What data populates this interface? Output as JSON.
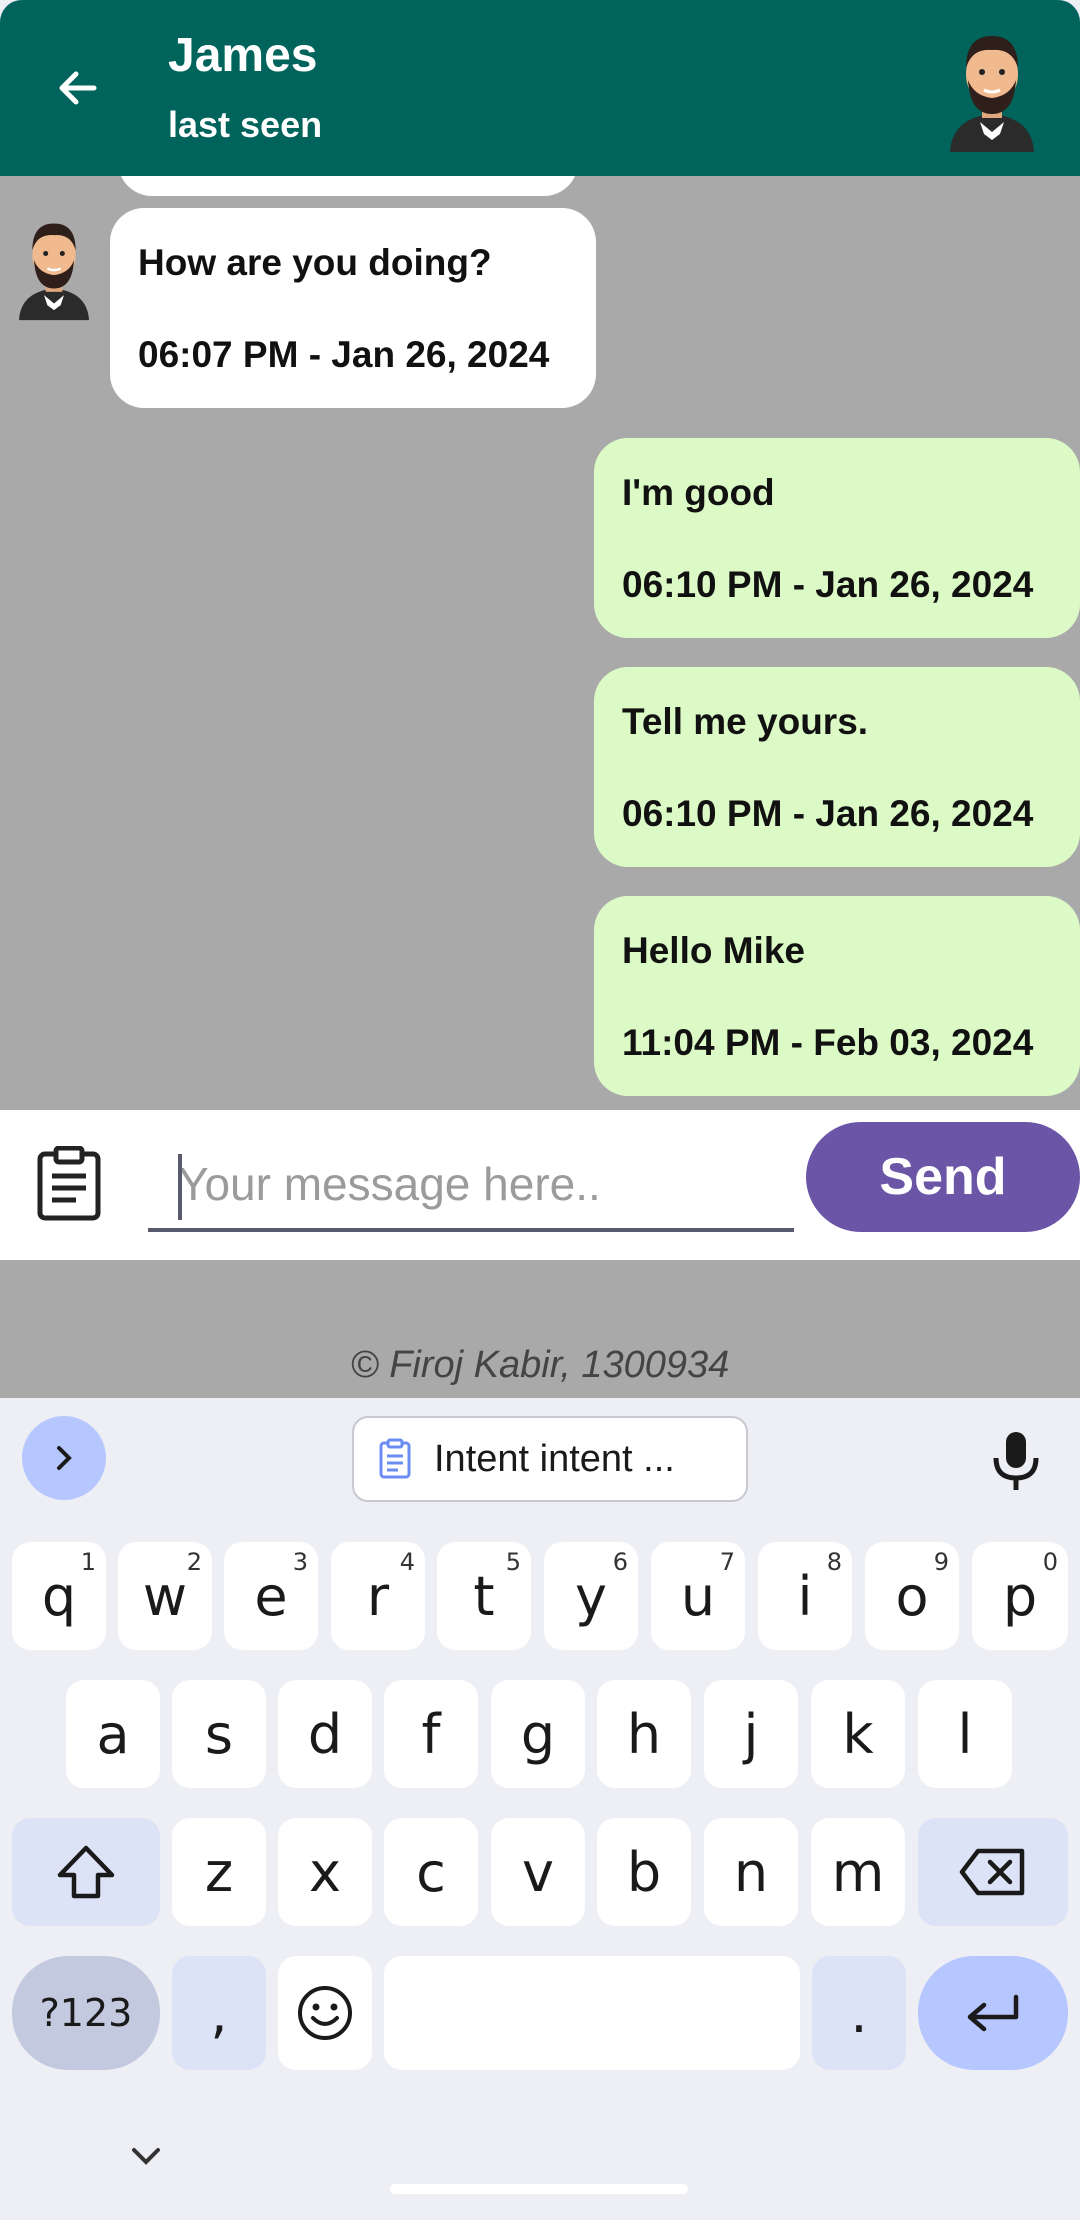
{
  "header": {
    "title": "James",
    "subtitle": "last seen",
    "back_icon": "arrow-left-icon",
    "avatar_icon": "bearded-man-avatar-icon",
    "color": "#00645c"
  },
  "messages": [
    {
      "direction": "incoming",
      "text": "How are you doing?",
      "time": "06:07 PM - Jan 26, 2024"
    },
    {
      "direction": "outgoing",
      "text": "I'm good",
      "time": "06:10 PM - Jan 26, 2024"
    },
    {
      "direction": "outgoing",
      "text": "Tell me yours.",
      "time": "06:10 PM - Jan 26, 2024"
    },
    {
      "direction": "outgoing",
      "text": "Hello Mike",
      "time": "11:04 PM - Feb 03, 2024"
    }
  ],
  "input": {
    "placeholder": "Your message here..",
    "attach_icon": "clipboard-icon",
    "send_label": "Send",
    "send_color": "#6a55a6"
  },
  "credit": "© Firoj Kabir, 1300934",
  "keyboard": {
    "suggestion": "Intent intent ...",
    "row1": [
      {
        "k": "q",
        "h": "1"
      },
      {
        "k": "w",
        "h": "2"
      },
      {
        "k": "e",
        "h": "3"
      },
      {
        "k": "r",
        "h": "4"
      },
      {
        "k": "t",
        "h": "5"
      },
      {
        "k": "y",
        "h": "6"
      },
      {
        "k": "u",
        "h": "7"
      },
      {
        "k": "i",
        "h": "8"
      },
      {
        "k": "o",
        "h": "9"
      },
      {
        "k": "p",
        "h": "0"
      }
    ],
    "row2": [
      "a",
      "s",
      "d",
      "f",
      "g",
      "h",
      "j",
      "k",
      "l"
    ],
    "row3": [
      "z",
      "x",
      "c",
      "v",
      "b",
      "n",
      "m"
    ],
    "sym_label": "?123",
    "comma": ",",
    "period": "."
  }
}
